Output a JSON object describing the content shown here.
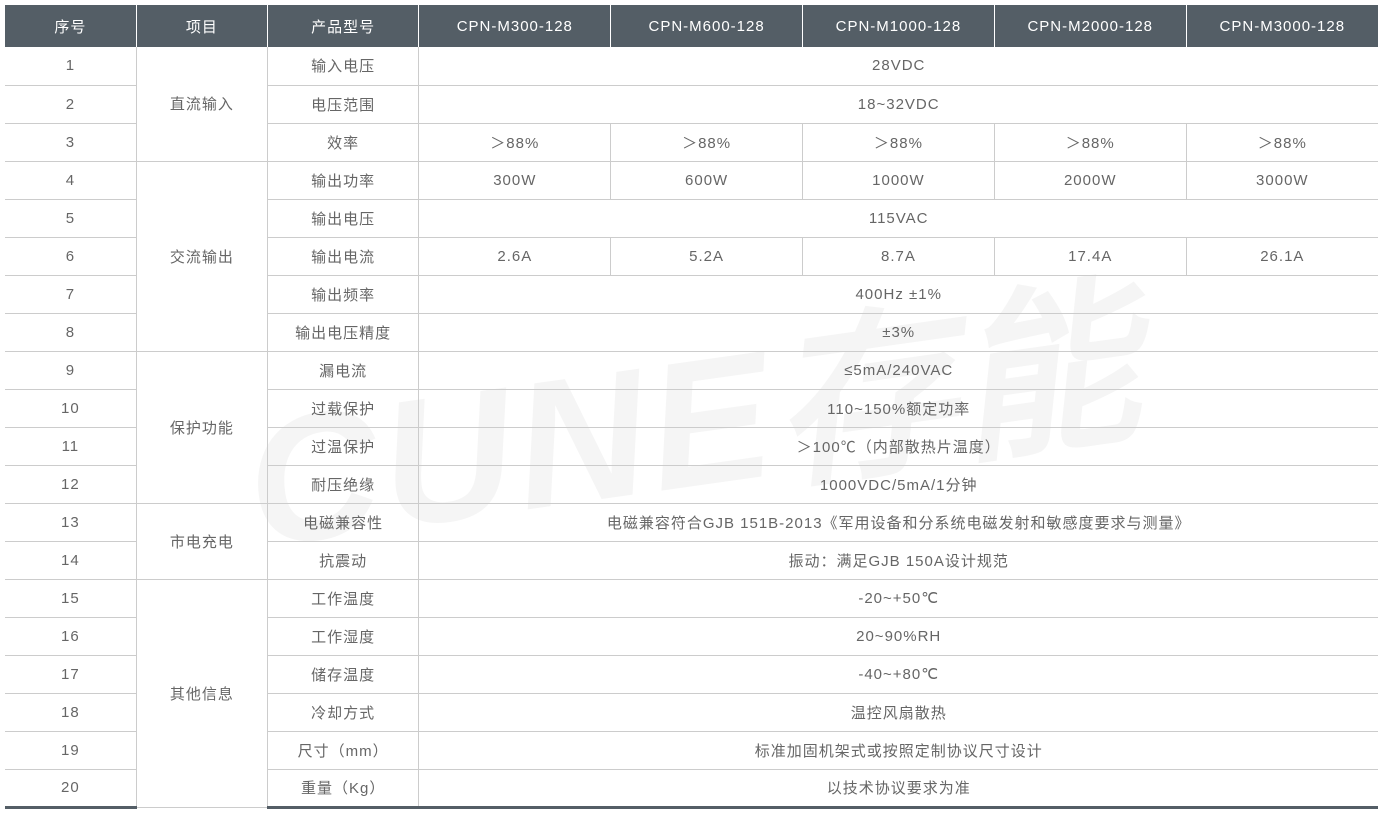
{
  "headers": {
    "seq": "序号",
    "category": "项目",
    "model": "产品型号",
    "m1": "CPN-M300-128",
    "m2": "CPN-M600-128",
    "m3": "CPN-M1000-128",
    "m4": "CPN-M2000-128",
    "m5": "CPN-M3000-128"
  },
  "categories": {
    "dc_input": "直流输入",
    "ac_output": "交流输出",
    "protection": "保护功能",
    "mains_charging": "市电充电",
    "other_info": "其他信息"
  },
  "params": {
    "input_voltage": "输入电压",
    "voltage_range": "电压范围",
    "efficiency": "效率",
    "output_power": "输出功率",
    "output_voltage": "输出电压",
    "output_current": "输出电流",
    "output_frequency": "输出频率",
    "output_v_accuracy": "输出电压精度",
    "leakage_current": "漏电流",
    "overload_prot": "过载保护",
    "overtemp_prot": "过温保护",
    "withstand_insul": "耐压绝缘",
    "emc": "电磁兼容性",
    "anti_vibration": "抗震动",
    "work_temp": "工作温度",
    "work_humidity": "工作湿度",
    "storage_temp": "储存温度",
    "cooling": "冷却方式",
    "dimensions": "尺寸（mm）",
    "weight": "重量（Kg）"
  },
  "values": {
    "input_voltage": "28VDC",
    "voltage_range": "18~32VDC",
    "efficiency": "＞88%",
    "output_power": {
      "m1": "300W",
      "m2": "600W",
      "m3": "1000W",
      "m4": "2000W",
      "m5": "3000W"
    },
    "output_voltage": "115VAC",
    "output_current": {
      "m1": "2.6A",
      "m2": "5.2A",
      "m3": "8.7A",
      "m4": "17.4A",
      "m5": "26.1A"
    },
    "output_frequency": "400Hz ±1%",
    "output_v_accuracy": "±3%",
    "leakage_current": "≤5mA/240VAC",
    "overload_prot": "110~150%额定功率",
    "overtemp_prot": "＞100℃（内部散热片温度）",
    "withstand_insul": "1000VDC/5mA/1分钟",
    "emc": "电磁兼容符合GJB 151B-2013《军用设备和分系统电磁发射和敏感度要求与测量》",
    "anti_vibration": "振动：满足GJB 150A设计规范",
    "work_temp": "-20~+50℃",
    "work_humidity": "20~90%RH",
    "storage_temp": "-40~+80℃",
    "cooling": "温控风扇散热",
    "dimensions": "标准加固机架式或按照定制协议尺寸设计",
    "weight": "以技术协议要求为准"
  },
  "seq": {
    "r1": "1",
    "r2": "2",
    "r3": "3",
    "r4": "4",
    "r5": "5",
    "r6": "6",
    "r7": "7",
    "r8": "8",
    "r9": "9",
    "r10": "10",
    "r11": "11",
    "r12": "12",
    "r13": "13",
    "r14": "14",
    "r15": "15",
    "r16": "16",
    "r17": "17",
    "r18": "18",
    "r19": "19",
    "r20": "20"
  }
}
